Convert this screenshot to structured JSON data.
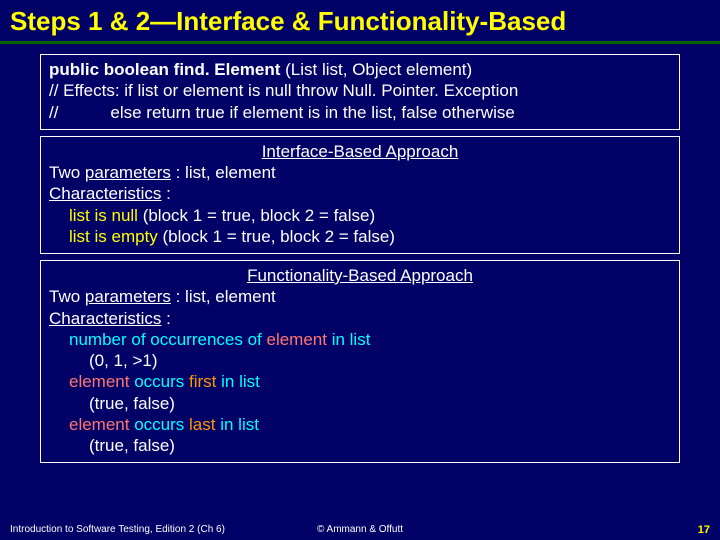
{
  "title": "Steps 1 & 2—Interface & Functionality-Based",
  "box1": {
    "l1a": "public boolean find. Element",
    "l1b": " (List list, Object element)",
    "l2": "// Effects: if list or element is null throw Null. Pointer. Exception",
    "l3": "//           else return true if element is in the list, false otherwise"
  },
  "box2": {
    "heading": "Interface-Based Approach",
    "params_a": "Two ",
    "params_u": "parameters",
    "params_b": " : list, element",
    "chars_u": "Characteristics",
    "chars_b": " :",
    "c1a": "list is null",
    "c1b": " (block 1 = true, block 2 = false)",
    "c2a": "list is empty",
    "c2b": " (block 1 = true, block 2 = false)"
  },
  "box3": {
    "heading": "Functionality-Based Approach",
    "params_a": "Two ",
    "params_u": "parameters",
    "params_b": " : list, element",
    "chars_u": "Characteristics",
    "chars_b": " :",
    "r1a": "number of occurrences of ",
    "r1b": "element",
    "r1c": " in list",
    "r1v": "(0, 1, >1)",
    "r2a": "element",
    "r2b": " occurs ",
    "r2c": "first",
    "r2d": " in list",
    "r2v": "(true, false)",
    "r3a": "element",
    "r3b": " occurs ",
    "r3c": "last",
    "r3d": " in list",
    "r3v": "(true, false)"
  },
  "footer": {
    "left": "Introduction to Software Testing, Edition 2  (Ch 6)",
    "center": "© Ammann & Offutt",
    "right": "17"
  }
}
